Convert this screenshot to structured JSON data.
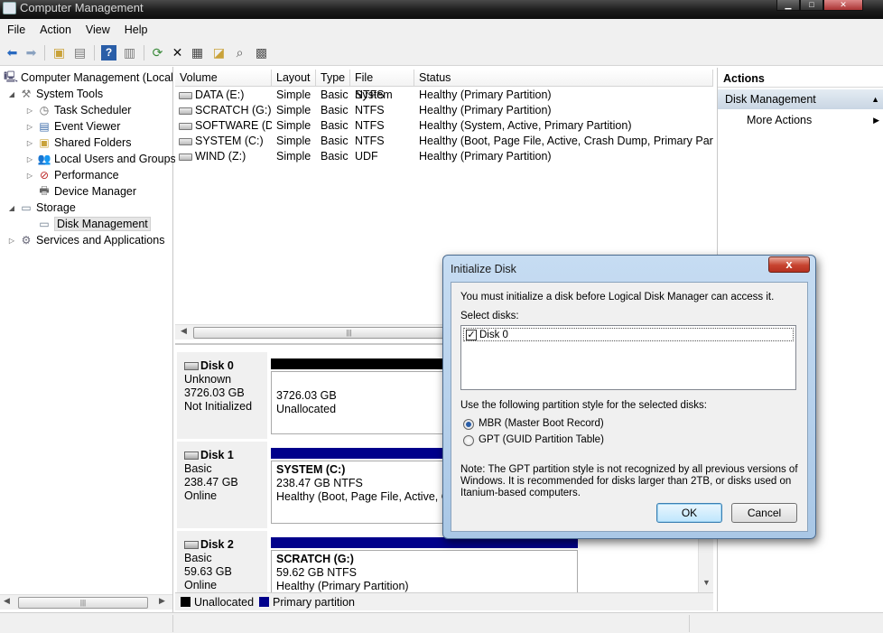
{
  "window": {
    "title": "Computer Management"
  },
  "menu": [
    "File",
    "Action",
    "View",
    "Help"
  ],
  "toolbar_icons": [
    "back-arrow-icon",
    "forward-arrow-icon",
    "folder-up-icon",
    "show-hide-tree-icon",
    "help-icon",
    "show-hide-action-pane-icon",
    "refresh-icon",
    "delete-icon",
    "properties-icon",
    "open-icon",
    "search-icon",
    "disk-properties-icon"
  ],
  "tree": {
    "root": "Computer Management (Local",
    "system_tools": "System Tools",
    "task_scheduler": "Task Scheduler",
    "event_viewer": "Event Viewer",
    "shared_folders": "Shared Folders",
    "local_users": "Local Users and Groups",
    "performance": "Performance",
    "device_manager": "Device Manager",
    "storage": "Storage",
    "disk_management": "Disk Management",
    "services": "Services and Applications"
  },
  "volumes": {
    "columns": [
      "Volume",
      "Layout",
      "Type",
      "File System",
      "Status"
    ],
    "rows": [
      {
        "volume": "DATA (E:)",
        "layout": "Simple",
        "type": "Basic",
        "fs": "NTFS",
        "status": "Healthy (Primary Partition)"
      },
      {
        "volume": "SCRATCH (G:)",
        "layout": "Simple",
        "type": "Basic",
        "fs": "NTFS",
        "status": "Healthy (Primary Partition)"
      },
      {
        "volume": "SOFTWARE (D:)",
        "layout": "Simple",
        "type": "Basic",
        "fs": "NTFS",
        "status": "Healthy (System, Active, Primary Partition)"
      },
      {
        "volume": "SYSTEM (C:)",
        "layout": "Simple",
        "type": "Basic",
        "fs": "NTFS",
        "status": "Healthy (Boot, Page File, Active, Crash Dump, Primary Partitio"
      },
      {
        "volume": "WIND (Z:)",
        "layout": "Simple",
        "type": "Basic",
        "fs": "UDF",
        "status": "Healthy (Primary Partition)"
      }
    ]
  },
  "disks": [
    {
      "name": "Disk 0",
      "kind": "Unknown",
      "size": "3726.03 GB",
      "state": "Not Initialized",
      "part_size": "3726.03 GB",
      "part_status": "Unallocated"
    },
    {
      "name": "Disk 1",
      "kind": "Basic",
      "size": "238.47 GB",
      "state": "Online",
      "part_name": "SYSTEM  (C:)",
      "part_size": "238.47 GB NTFS",
      "part_status": "Healthy (Boot, Page File, Active, Cr"
    },
    {
      "name": "Disk 2",
      "kind": "Basic",
      "size": "59.63 GB",
      "state": "Online",
      "part_name": "SCRATCH  (G:)",
      "part_size": "59.62 GB NTFS",
      "part_status": "Healthy (Primary Partition)"
    }
  ],
  "legend": {
    "unallocated": "Unallocated",
    "primary": "Primary partition"
  },
  "colors": {
    "unallocated": "#000000",
    "primary": "#00008b",
    "selection": "#c9d6e3"
  },
  "actions": {
    "header": "Actions",
    "section": "Disk Management",
    "more": "More Actions"
  },
  "dialog": {
    "title": "Initialize Disk",
    "intro": "You must initialize a disk before Logical Disk Manager can access it.",
    "select_label": "Select disks:",
    "disk_item": "Disk 0",
    "style_label": "Use the following partition style for the selected disks:",
    "mbr": "MBR (Master Boot Record)",
    "gpt": "GPT (GUID Partition Table)",
    "note1": "Note: The GPT partition style is not recognized by all previous versions of",
    "note2": "Windows. It is recommended for disks larger than 2TB, or disks used on",
    "note3": "Itanium-based computers.",
    "ok": "OK",
    "cancel": "Cancel",
    "close_glyph": "x"
  }
}
